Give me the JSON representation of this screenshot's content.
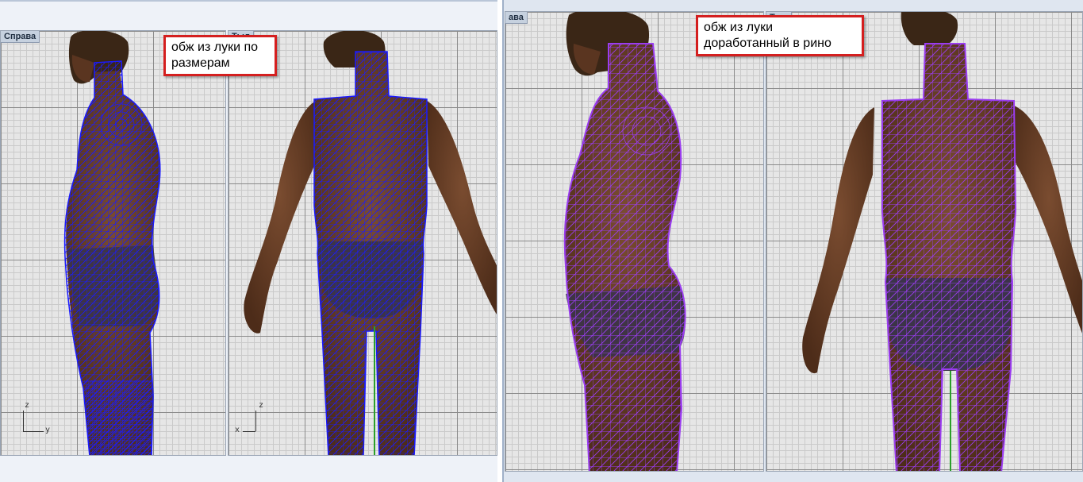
{
  "left_panel": {
    "viewport_right_label": "Справа",
    "viewport_back_label": "Тыл",
    "callout_lines": [
      "обж из луки по",
      "размерам"
    ],
    "wire_color": "#1a1aff",
    "axis_right": {
      "vertical": "z",
      "horizontal": "y"
    },
    "axis_back": {
      "vertical": "z",
      "horizontal": "x"
    }
  },
  "right_panel": {
    "viewport_right_label": "ава",
    "viewport_back_label": "Тыл",
    "callout_lines": [
      "обж из луки",
      "доработанный в рино"
    ],
    "wire_color": "#8a2be2"
  },
  "colors": {
    "callout_border": "#d41f1f",
    "skin": "#6b4128",
    "hair": "#3a2616",
    "underwear": "#3b3448",
    "axis_green": "#2aa02a"
  }
}
